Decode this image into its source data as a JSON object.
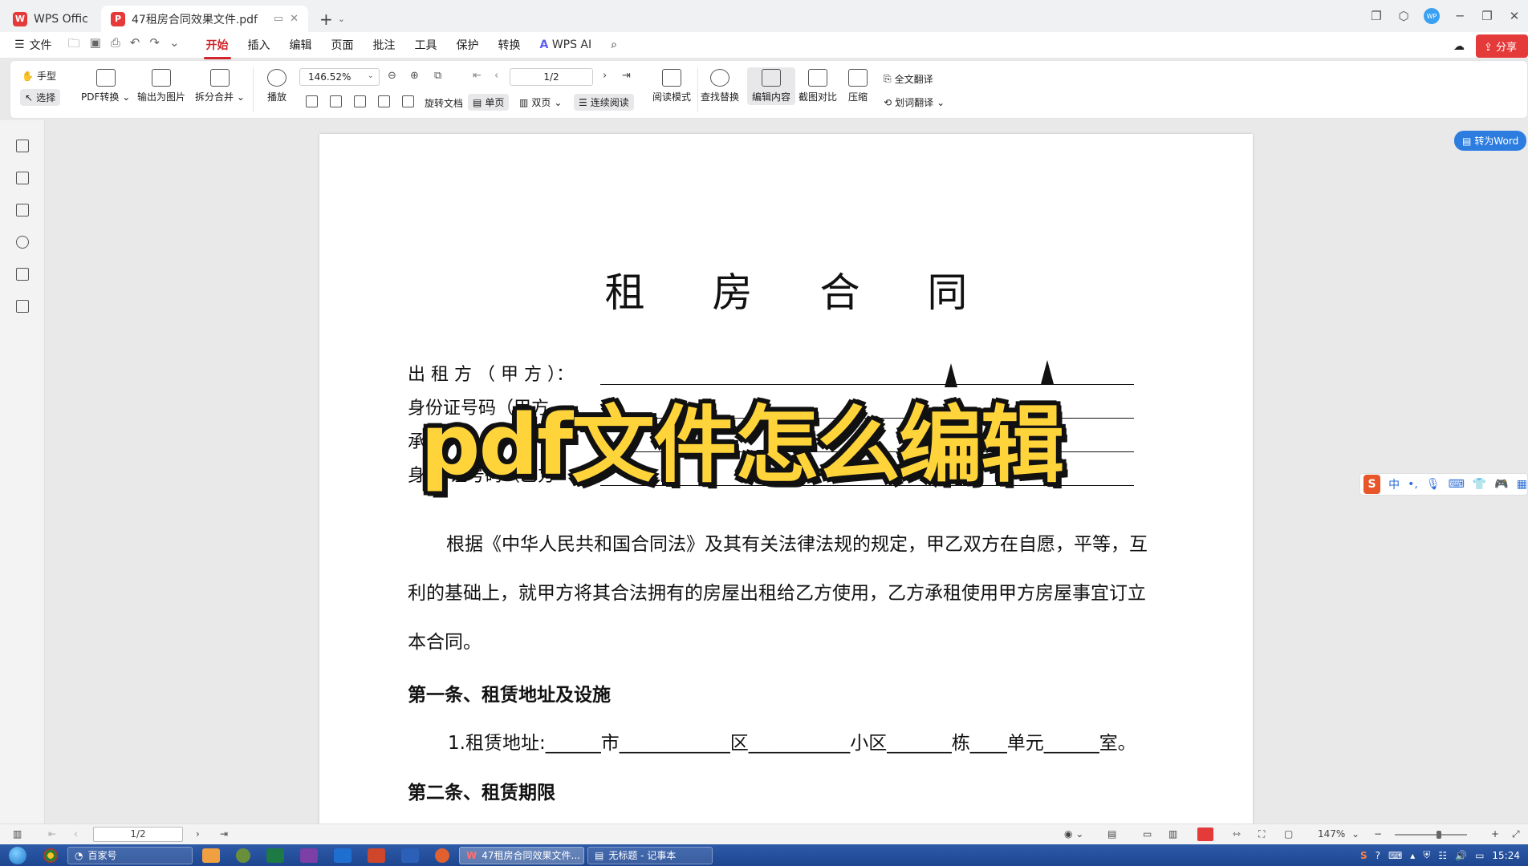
{
  "tabs": {
    "home_label": "WPS Office",
    "doc_label": "47租房合同效果文件.pdf"
  },
  "menubar": {
    "file_label": "文件",
    "items": [
      "开始",
      "插入",
      "编辑",
      "页面",
      "批注",
      "工具",
      "保护",
      "转换"
    ],
    "ai_label": "WPS AI",
    "share_label": "分享"
  },
  "ribbon": {
    "hand_label": "手型",
    "select_label": "选择",
    "pdf_convert_label": "PDF转换",
    "export_image_label": "输出为图片",
    "split_merge_label": "拆分合并",
    "play_label": "播放",
    "zoom_value": "146.52%",
    "page_value": "1/2",
    "rotate_label": "旋转文档",
    "single_page_label": "单页",
    "double_page_label": "双页",
    "continuous_label": "连续阅读",
    "read_mode_label": "阅读模式",
    "find_replace_label": "查找替换",
    "edit_content_label": "编辑内容",
    "screenshot_compare_label": "截图对比",
    "compress_label": "压缩",
    "full_translate_label": "全文翻译",
    "word_translate_label": "划词翻译"
  },
  "to_word_label": "转为Word",
  "document": {
    "title": "租 房 合 同",
    "party_lines": [
      "出 租 方 （ 甲 方 ）：",
      "身份证号码（甲方",
      "承",
      "身"
    ],
    "party_line_2_suffix": "：",
    "party_line_4_suffix": "证号码（乙方",
    "intro_line1": "根据《中华人民共和国合同法》及其有关法律法规的规定，甲乙双方在自愿，平等，互",
    "intro_line2": "利的基础上，就甲方将其合法拥有的房屋出租给乙方使用，乙方承租使用甲方房屋事宜订立",
    "intro_line3": "本合同。",
    "section1_heading": "第一条、租赁地址及设施",
    "address_line": "1.租赁地址:______市____________区___________小区_______栋____单元______室。",
    "section2_heading": "第二条、租赁期限"
  },
  "overlay_caption": "pdf文件怎么编辑",
  "ime_label": "中",
  "statusbar": {
    "page_value": "1/2",
    "zoom_value": "147%"
  },
  "taskbar": {
    "baijia_label": "百家号",
    "wps_task_label": "47租房合同效果文件...",
    "notepad_task_label": "无标题 - 记事本",
    "clock": "15:24"
  }
}
